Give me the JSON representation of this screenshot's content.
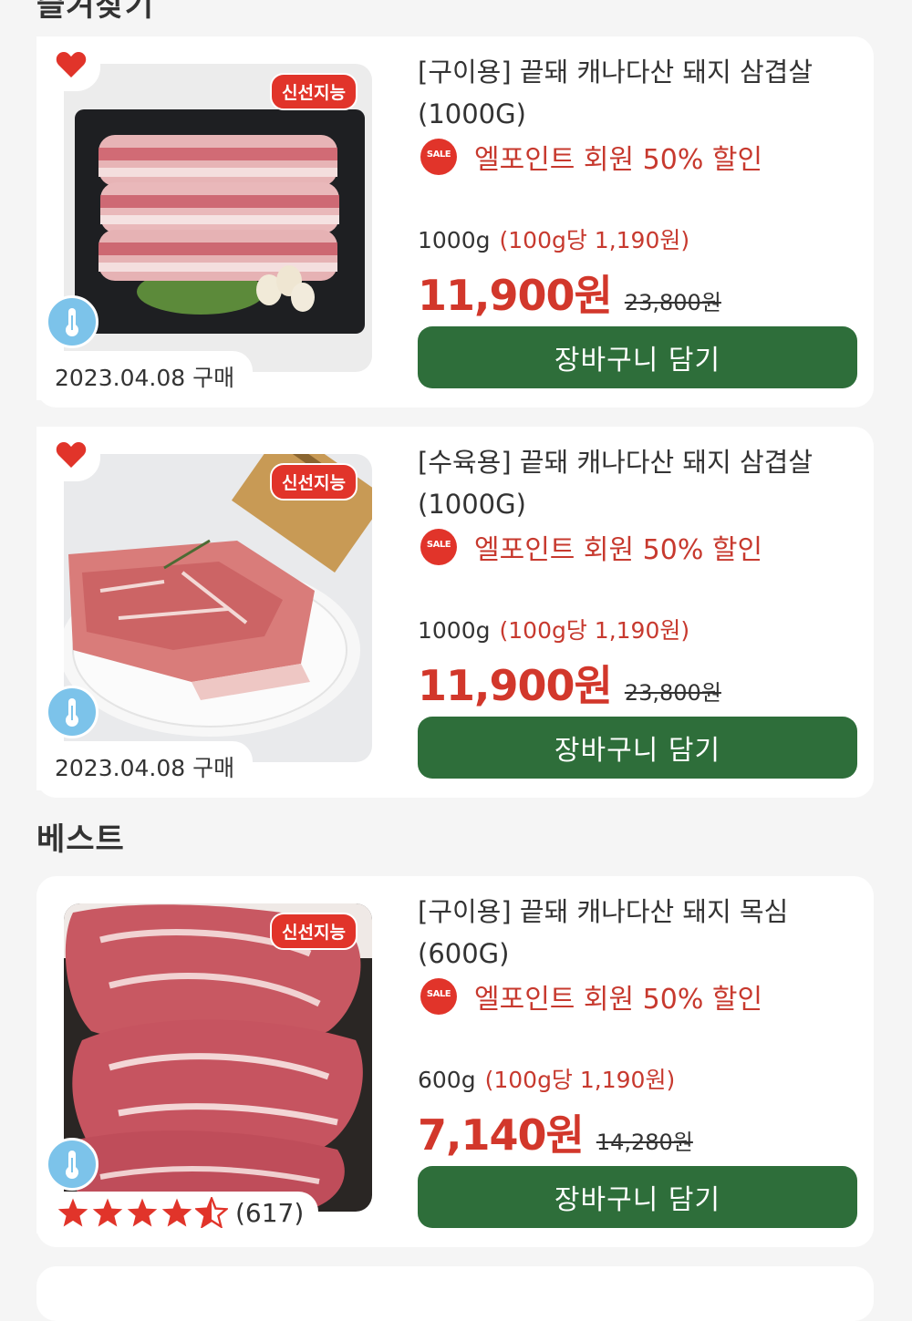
{
  "sections": {
    "favorites_title": "즐겨찾기",
    "best_title": "베스트"
  },
  "colors": {
    "accent_red": "#d2372b",
    "button_green": "#2e6e3a",
    "temp_blue": "#7cc3ea"
  },
  "products": [
    {
      "name": "[구이용] 끝돼 캐나다산 돼지 삼겹살 (1000G)",
      "fresh_label": "신선지능",
      "sale_badge": "SALE",
      "promo": "엘포인트 회원 50% 할인",
      "weight": "1000g",
      "unit_price": "(100g당 1,190원)",
      "price": "11,900원",
      "original_price": "23,800원",
      "date": "2023.04.08 구매",
      "button": "장바구니 담기",
      "favorite": true
    },
    {
      "name": "[수육용] 끝돼 캐나다산 돼지 삼겹살 (1000G)",
      "fresh_label": "신선지능",
      "sale_badge": "SALE",
      "promo": "엘포인트 회원 50% 할인",
      "weight": "1000g",
      "unit_price": "(100g당 1,190원)",
      "price": "11,900원",
      "original_price": "23,800원",
      "date": "2023.04.08 구매",
      "button": "장바구니 담기",
      "favorite": true
    },
    {
      "name": "[구이용] 끝돼 캐나다산 돼지 목심 (600G)",
      "fresh_label": "신선지능",
      "sale_badge": "SALE",
      "promo": "엘포인트 회원 50% 할인",
      "weight": "600g",
      "unit_price": "(100g당 1,190원)",
      "price": "7,140원",
      "original_price": "14,280원",
      "rating": 4.5,
      "review_count": "(617)",
      "button": "장바구니 담기"
    }
  ]
}
